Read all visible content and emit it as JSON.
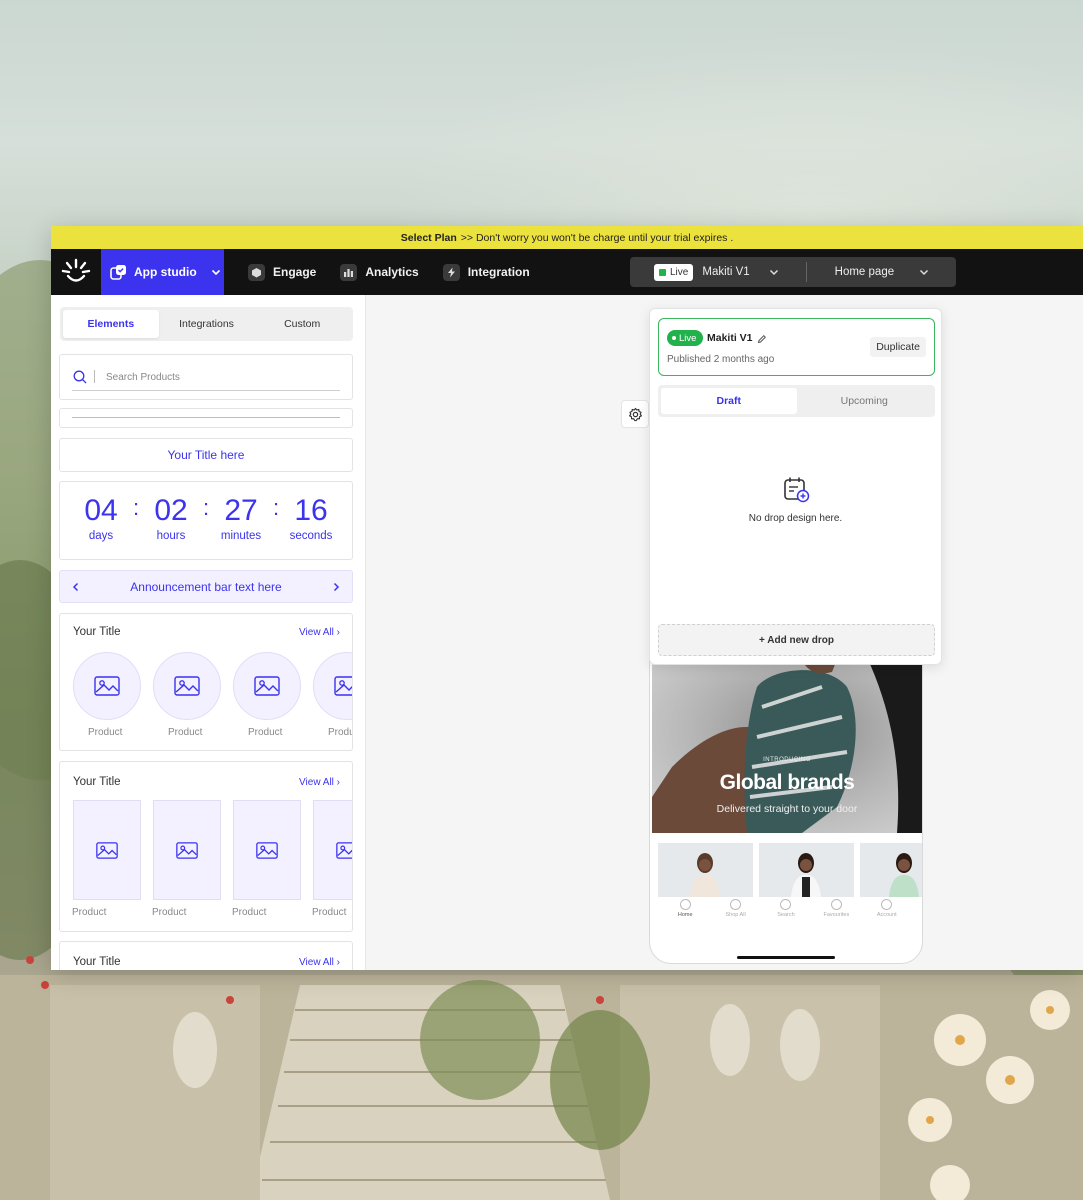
{
  "trial_bar": {
    "plan_link": "Select Plan",
    "message": ">> Don't worry you won't be charge until your trial expires ."
  },
  "topnav": {
    "app_studio": "App studio",
    "items": [
      {
        "label": "Engage",
        "icon": "cube-icon"
      },
      {
        "label": "Analytics",
        "icon": "bar-chart-icon"
      },
      {
        "label": "Integration",
        "icon": "lightning-icon"
      }
    ],
    "selector": {
      "live": "Live",
      "version": "Makiti V1",
      "page": "Home page"
    }
  },
  "left_panel": {
    "tabs": [
      "Elements",
      "Integrations",
      "Custom"
    ],
    "active_tab": "Elements",
    "search_placeholder": "Search Products",
    "title_block": "Your Title here",
    "countdown": [
      {
        "value": "04",
        "label": "days"
      },
      {
        "value": "02",
        "label": "hours"
      },
      {
        "value": "27",
        "label": "minutes"
      },
      {
        "value": "16",
        "label": "seconds"
      }
    ],
    "announcement": "Announcement bar text here",
    "sections": [
      {
        "title": "Your Title",
        "view_all": "View All",
        "products": [
          "Product",
          "Product",
          "Product",
          "Produ"
        ]
      },
      {
        "title": "Your Title",
        "view_all": "View All",
        "products": [
          "Product",
          "Product",
          "Product",
          "Product"
        ]
      },
      {
        "title": "Your Title",
        "view_all": "View All"
      }
    ]
  },
  "popup": {
    "live_badge": "Live",
    "name": "Makiti V1",
    "published": "Published 2 months ago",
    "duplicate": "Duplicate",
    "tabs": [
      "Draft",
      "Upcoming"
    ],
    "empty_message": "No drop design here.",
    "add_drop": "+ Add new drop"
  },
  "preview": {
    "intro": "INTRODUCING",
    "headline": "Global brands",
    "subheadline": "Delivered straight to your door",
    "tabbar": [
      "Home",
      "Shop All",
      "Search",
      "Favourites",
      "Account"
    ]
  },
  "colors": {
    "accent": "#3b33ee",
    "trial_bar": "#ece23e",
    "nav_bg": "#121212",
    "live_green": "#22b24c"
  }
}
